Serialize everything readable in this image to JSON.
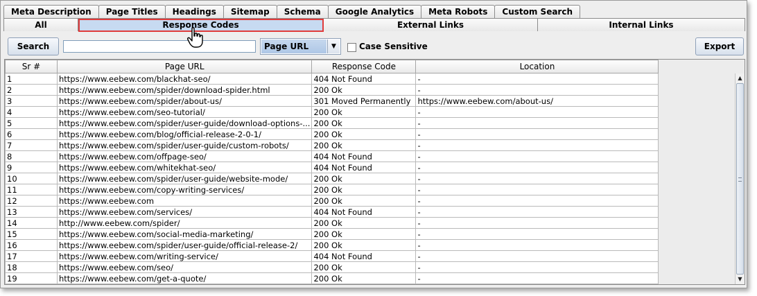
{
  "tabs_primary": [
    "Meta Description",
    "Page Titles",
    "Headings",
    "Sitemap",
    "Schema",
    "Google Analytics",
    "Meta Robots",
    "Custom Search"
  ],
  "tabs_secondary": [
    "All",
    "Response Codes",
    "External Links",
    "Internal Links"
  ],
  "selected_tab": "Response Codes",
  "toolbar": {
    "search_label": "Search",
    "search_value": "",
    "filter_selected": "Page URL",
    "case_sensitive_label": "Case Sensitive",
    "case_sensitive_checked": false,
    "export_label": "Export"
  },
  "table": {
    "columns": [
      "Sr #",
      "Page URL",
      "Response Code",
      "Location"
    ],
    "rows": [
      [
        "1",
        "https://www.eebew.com/blackhat-seo/",
        "404 Not Found",
        "-"
      ],
      [
        "2",
        "https://www.eebew.com/spider/download-spider.html",
        "200 Ok",
        "-"
      ],
      [
        "3",
        "https://www.eebew.com/spider/about-us/",
        "301 Moved Permanently",
        "https://www.eebew.com/about-us/"
      ],
      [
        "4",
        "https://www.eebew.com/seo-tutorial/",
        "200 Ok",
        "-"
      ],
      [
        "5",
        "https://www.eebew.com/spider/user-guide/download-options-...",
        "200 Ok",
        "-"
      ],
      [
        "6",
        "https://www.eebew.com/blog/official-release-2-0-1/",
        "200 Ok",
        "-"
      ],
      [
        "7",
        "https://www.eebew.com/spider/user-guide/custom-robots/",
        "200 Ok",
        "-"
      ],
      [
        "8",
        "https://www.eebew.com/offpage-seo/",
        "404 Not Found",
        "-"
      ],
      [
        "9",
        "https://www.eebew.com/whitekhat-seo/",
        "404 Not Found",
        "-"
      ],
      [
        "10",
        "https://www.eebew.com/spider/user-guide/website-mode/",
        "200 Ok",
        "-"
      ],
      [
        "11",
        "https://www.eebew.com/copy-writing-services/",
        "200 Ok",
        "-"
      ],
      [
        "12",
        "https://www.eebew.com",
        "200 Ok",
        "-"
      ],
      [
        "13",
        "https://www.eebew.com/services/",
        "404 Not Found",
        "-"
      ],
      [
        "14",
        "http://www.eebew.com/spider/",
        "200 Ok",
        "-"
      ],
      [
        "15",
        "https://www.eebew.com/social-media-marketing/",
        "200 Ok",
        "-"
      ],
      [
        "16",
        "https://www.eebew.com/spider/user-guide/official-release-2/",
        "200 Ok",
        "-"
      ],
      [
        "17",
        "https://www.eebew.com/writing-service/",
        "404 Not Found",
        "-"
      ],
      [
        "18",
        "https://www.eebew.com/seo/",
        "200 Ok",
        "-"
      ],
      [
        "19",
        "https://www.eebew.com/get-a-quote/",
        "200 Ok",
        "-"
      ]
    ]
  },
  "colors": {
    "selected_tab": "#c7daf1",
    "highlight_border": "#e03b3b",
    "window_bg": "#eeeeee"
  },
  "icons": {
    "cursor": "hand-pointer-icon",
    "dropdown": "chevron-down-icon",
    "scroll_up": "scroll-up-arrow-icon",
    "scroll_down": "scroll-down-arrow-icon"
  }
}
